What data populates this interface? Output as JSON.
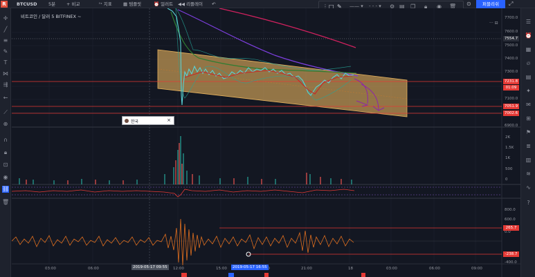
{
  "header": {
    "logo_letter": "R",
    "symbol": "BTCUSD",
    "interval": "5분",
    "compare": "비교",
    "indicators": "지표",
    "templates": "템플릿",
    "alert": "얼러트",
    "replay": "리플레이",
    "trade_button": "퍼블리쉬"
  },
  "legend": {
    "title": "비트코인 / 달러  5  BITFINEX",
    "arrow": "~"
  },
  "indicator_box": {
    "label": "한국",
    "close": "×"
  },
  "price_axis": {
    "labels": [
      "7700.0",
      "7600.0",
      "7500.0",
      "7400.0",
      "7300.0",
      "7100.0",
      "7000.0",
      "6900.0"
    ],
    "tags": [
      {
        "text": "7554.7",
        "color": "#2a2e39"
      },
      {
        "text": "7231.8",
        "color": "#e53935"
      },
      {
        "text": "01:09",
        "color": "#e53935"
      },
      {
        "text": "7051.9",
        "color": "#e53935"
      },
      {
        "text": "7002.6",
        "color": "#e53935"
      }
    ]
  },
  "volume_axis": {
    "labels": [
      "2K",
      "1.5K",
      "1K",
      "500",
      "0"
    ]
  },
  "osc_axis": {
    "labels": [
      "800.0",
      "600.0",
      "400.0",
      "200.0",
      "0.0",
      "-200.0",
      "-400.0"
    ],
    "tags": [
      {
        "text": "265.7",
        "color": "#e53935"
      },
      {
        "text": "-238.7",
        "color": "#e53935"
      }
    ]
  },
  "time_axis": {
    "labels": [
      "03:00",
      "06:00",
      "12:00",
      "15:00",
      "18:00",
      "21:00",
      "18",
      "03:00",
      "06:00",
      "09:00"
    ],
    "tags": [
      "2019-05-17  09:55",
      "2019-05-17  16:55"
    ]
  },
  "colors": {
    "background": "#131722",
    "channel_fill": "#d9a75a",
    "price_line": "#e53935",
    "ma_purple": "#7e3fe0",
    "ma_magenta": "#d0215e",
    "ma_green": "#2e7d32",
    "osc_line": "#e06f1f"
  },
  "icons": {
    "crosshair": "crosshair-icon",
    "trend": "trendline-icon",
    "fib": "fib-icon",
    "text": "text-icon",
    "pattern": "pattern-icon",
    "measure": "ruler-icon",
    "zoom": "zoom-icon",
    "magnet": "magnet-icon",
    "lock": "lock-icon",
    "eye": "eye-icon",
    "trash": "trash-icon"
  }
}
